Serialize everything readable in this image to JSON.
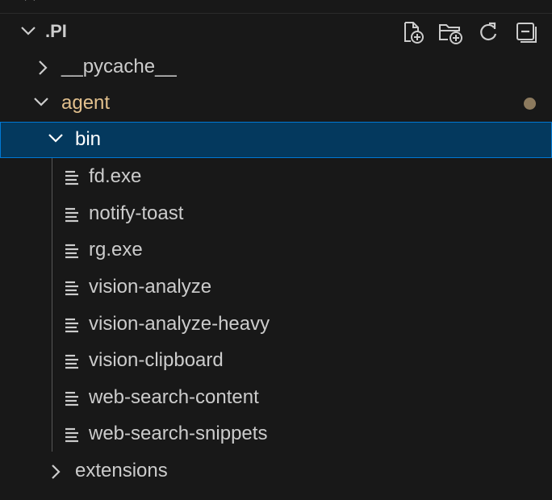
{
  "explorer": {
    "section_title": ".PI",
    "actions": [
      {
        "name": "new-file-icon",
        "tooltip": "New File..."
      },
      {
        "name": "new-folder-icon",
        "tooltip": "New Folder..."
      },
      {
        "name": "refresh-icon",
        "tooltip": "Refresh Explorer"
      },
      {
        "name": "collapse-all-icon",
        "tooltip": "Collapse Folders in Explorer"
      }
    ],
    "tree": {
      "pycache": {
        "label": "__pycache__",
        "expanded": false
      },
      "agent": {
        "label": "agent",
        "expanded": true,
        "modified": true,
        "modified_color": "#e2c08d"
      },
      "bin": {
        "label": "bin",
        "expanded": true,
        "selected": true
      },
      "files": [
        {
          "label": "fd.exe"
        },
        {
          "label": "notify-toast"
        },
        {
          "label": "rg.exe"
        },
        {
          "label": "vision-analyze"
        },
        {
          "label": "vision-analyze-heavy"
        },
        {
          "label": "vision-clipboard"
        },
        {
          "label": "web-search-content"
        },
        {
          "label": "web-search-snippets"
        }
      ],
      "extensions": {
        "label": "extensions",
        "expanded": false
      }
    },
    "colors": {
      "background": "#181818",
      "selection_bg": "#04395e",
      "selection_border": "#0078d4",
      "text": "#cccccc"
    }
  }
}
